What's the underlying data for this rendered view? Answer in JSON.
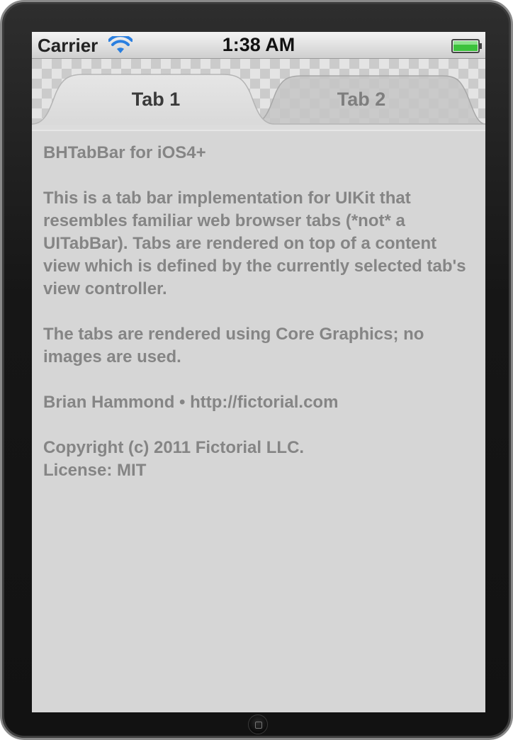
{
  "status_bar": {
    "carrier": "Carrier",
    "time": "1:38 AM",
    "wifi_icon": "wifi-icon",
    "battery_icon": "battery-icon"
  },
  "tabs": [
    {
      "label": "Tab 1",
      "selected": true
    },
    {
      "label": "Tab 2",
      "selected": false
    }
  ],
  "content": {
    "title": "BHTabBar for iOS4+",
    "description": "This is a tab bar implementation for UIKit that resembles familiar web browser tabs (*not* a UITabBar). Tabs are rendered on top of a content view which is defined by the currently selected tab's view controller.",
    "rendering_note": "The tabs are rendered using Core Graphics; no images are used.",
    "author_line": "Brian Hammond • http://fictorial.com",
    "copyright": "Copyright (c) 2011 Fictorial LLC.",
    "license": "License: MIT"
  },
  "colors": {
    "content_background": "#d6d6d6",
    "selected_tab": "#dcdcdc",
    "unselected_tab": "#c4c4c4",
    "text": "#858585"
  }
}
